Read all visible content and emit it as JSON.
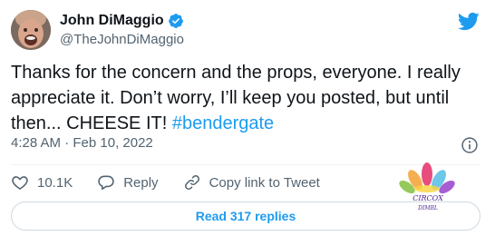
{
  "author": {
    "display_name": "John DiMaggio",
    "handle": "@TheJohnDiMaggio",
    "verified": true
  },
  "tweet": {
    "text_before_hashtag": "Thanks for the concern and the props, everyone. I really appreciate it. Don’t worry, I’ll keep you posted, but until then... CHEESE IT! ",
    "hashtag": "#bendergate",
    "timestamp": "4:28 AM · Feb 10, 2022"
  },
  "actions": {
    "like_count": "10.1K",
    "reply_label": "Reply",
    "copy_link_label": "Copy link to Tweet"
  },
  "replies_button": {
    "label": "Read 317 replies"
  },
  "watermark": {
    "line1": "CIRCOX",
    "line2": "DIMBL"
  },
  "colors": {
    "accent": "#1d9bf0",
    "text": "#0f1419",
    "secondary": "#536471",
    "border": "#cfd9de"
  },
  "icons": {
    "platform": "twitter-bird-icon",
    "verified": "verified-badge-icon",
    "info": "info-icon",
    "like": "heart-icon",
    "reply": "reply-bubble-icon",
    "copy_link": "link-icon"
  }
}
